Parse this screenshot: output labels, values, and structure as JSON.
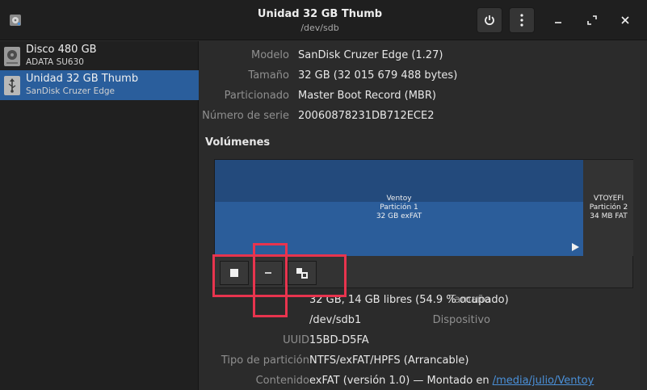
{
  "header": {
    "title": "Unidad 32 GB Thumb",
    "subtitle": "/dev/sdb"
  },
  "sidebar": {
    "items": [
      {
        "name": "Disco 480 GB",
        "subtitle": "ADATA SU630",
        "icon": "hard-disk-icon",
        "selected": false
      },
      {
        "name": "Unidad 32 GB Thumb",
        "subtitle": "SanDisk Cruzer Edge",
        "icon": "usb-drive-icon",
        "selected": true
      }
    ]
  },
  "drive": {
    "model_label": "Modelo",
    "model_value": "SanDisk Cruzer Edge (1.27)",
    "size_label": "Tamaño",
    "size_value": "32 GB (32 015 679 488 bytes)",
    "partitioning_label": "Particionado",
    "partitioning_value": "Master Boot Record (MBR)",
    "serial_label": "Número de serie",
    "serial_value": "20060878231DB712ECE2"
  },
  "volumes": {
    "title": "Volúmenes",
    "partitions": [
      {
        "name": "Ventoy",
        "part": "Partición 1",
        "size": "32 GB exFAT"
      },
      {
        "name": "VTOYEFI",
        "part": "Partición 2",
        "size": "34 MB FAT"
      }
    ]
  },
  "volume_details": {
    "size_label": "Tamaño",
    "size_value": "32 GB, 14 GB libres (54.9 % ocupado)",
    "device_label": "Dispositivo",
    "device_value": "/dev/sdb1",
    "uuid_label": "UUID",
    "uuid_value": "15BD-D5FA",
    "type_label": "Tipo de partición",
    "type_value": "NTFS/exFAT/HPFS (Arrancable)",
    "content_label": "Contenido",
    "content_value": "exFAT (versión 1.0) — Montado en",
    "mount_link": "/media/julio/Ventoy"
  },
  "colors": {
    "selection": "#2a5e9c",
    "partition": "#2b5d9a",
    "annotation": "#e8344e",
    "link": "#4a90d9"
  }
}
